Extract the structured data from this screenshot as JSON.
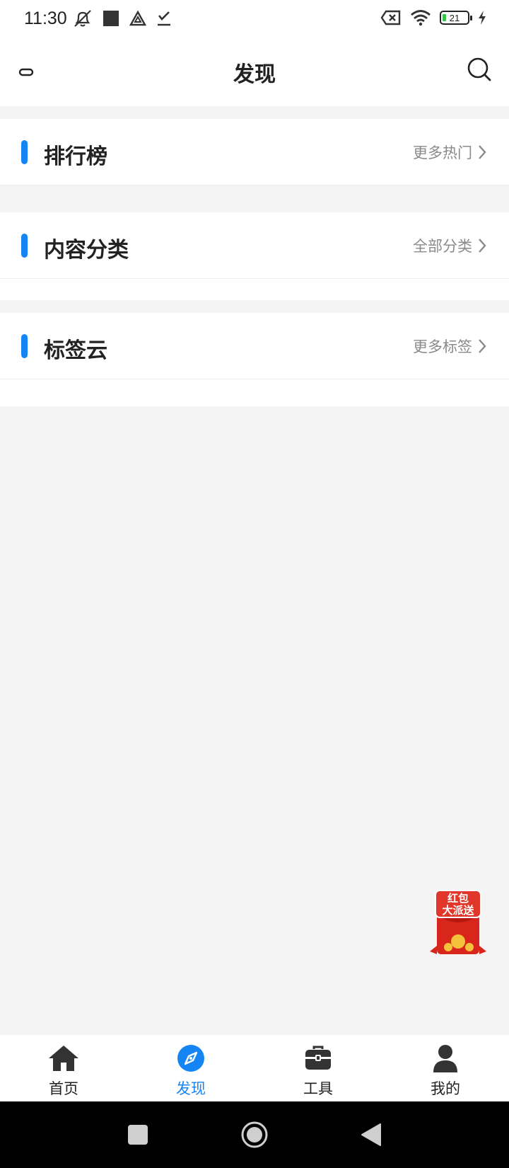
{
  "status_bar": {
    "time": "11:30",
    "battery": "21"
  },
  "header": {
    "title": "发现"
  },
  "sections": [
    {
      "title": "排行榜",
      "more": "更多热门"
    },
    {
      "title": "内容分类",
      "more": "全部分类"
    },
    {
      "title": "标签云",
      "more": "更多标签"
    }
  ],
  "floating_ad": {
    "line1": "红包",
    "line2": "大派送"
  },
  "bottom_nav": {
    "items": [
      {
        "label": "首页",
        "icon": "home-icon"
      },
      {
        "label": "发现",
        "icon": "compass-icon",
        "active": true
      },
      {
        "label": "工具",
        "icon": "toolbox-icon"
      },
      {
        "label": "我的",
        "icon": "user-icon"
      }
    ]
  },
  "colors": {
    "accent": "#1685f4",
    "background": "#f4f4f4",
    "text": "#222222",
    "muted": "#8a8a8a"
  }
}
